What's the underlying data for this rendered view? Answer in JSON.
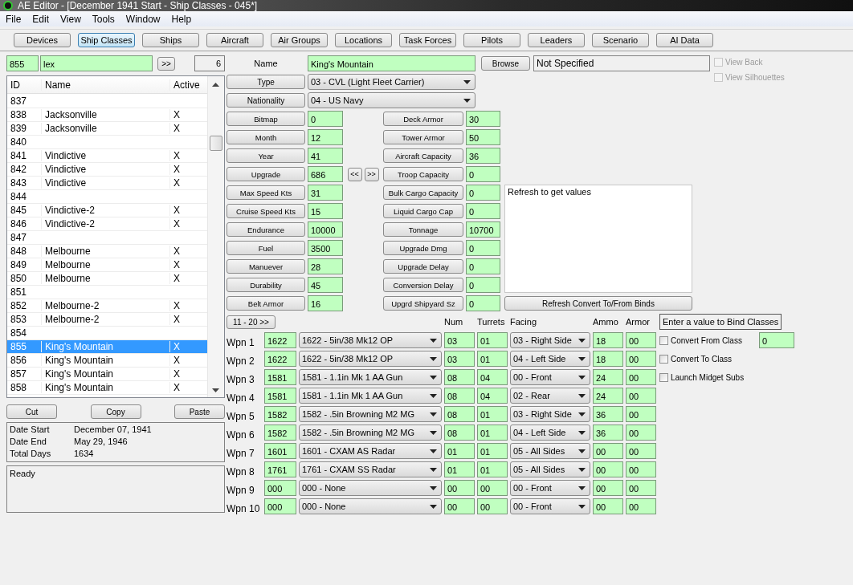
{
  "window": {
    "title": "AE Editor - [December 1941 Start - Ship Classes - 045*]"
  },
  "menu": [
    "File",
    "Edit",
    "View",
    "Tools",
    "Window",
    "Help"
  ],
  "toolbar": [
    {
      "label": "Devices",
      "selected": false
    },
    {
      "label": "Ship Classes",
      "selected": true
    },
    {
      "label": "Ships",
      "selected": false
    },
    {
      "label": "Aircraft",
      "selected": false
    },
    {
      "label": "Air Groups",
      "selected": false
    },
    {
      "label": "Locations",
      "selected": false
    },
    {
      "label": "Task Forces",
      "selected": false
    },
    {
      "label": "Pilots",
      "selected": false
    },
    {
      "label": "Leaders",
      "selected": false
    },
    {
      "label": "Scenario",
      "selected": false
    },
    {
      "label": "AI Data",
      "selected": false
    }
  ],
  "search": {
    "id": "855",
    "text": "lex",
    "go": ">>",
    "count": "6"
  },
  "list": {
    "columns": [
      "ID",
      "Name",
      "Active"
    ],
    "rows": [
      {
        "id": "837",
        "selected": false
      },
      {
        "id": "838",
        "name": "Jacksonville",
        "active": "X",
        "selected": false
      },
      {
        "id": "839",
        "name": "Jacksonville",
        "active": "X",
        "selected": false
      },
      {
        "id": "840",
        "selected": false
      },
      {
        "id": "841",
        "name": "Vindictive",
        "active": "X",
        "selected": false
      },
      {
        "id": "842",
        "name": "Vindictive",
        "active": "X",
        "selected": false
      },
      {
        "id": "843",
        "name": "Vindictive",
        "active": "X",
        "selected": false
      },
      {
        "id": "844",
        "selected": false
      },
      {
        "id": "845",
        "name": "Vindictive-2",
        "active": "X",
        "selected": false
      },
      {
        "id": "846",
        "name": "Vindictive-2",
        "active": "X",
        "selected": false
      },
      {
        "id": "847",
        "selected": false
      },
      {
        "id": "848",
        "name": "Melbourne",
        "active": "X",
        "selected": false
      },
      {
        "id": "849",
        "name": "Melbourne",
        "active": "X",
        "selected": false
      },
      {
        "id": "850",
        "name": "Melbourne",
        "active": "X",
        "selected": false
      },
      {
        "id": "851",
        "selected": false
      },
      {
        "id": "852",
        "name": "Melbourne-2",
        "active": "X",
        "selected": false
      },
      {
        "id": "853",
        "name": "Melbourne-2",
        "active": "X",
        "selected": false
      },
      {
        "id": "854",
        "selected": false
      },
      {
        "id": "855",
        "name": "King's Mountain",
        "active": "X",
        "selected": true
      },
      {
        "id": "856",
        "name": "King's Mountain",
        "active": "X",
        "selected": false
      },
      {
        "id": "857",
        "name": "King's Mountain",
        "active": "X",
        "selected": false
      },
      {
        "id": "858",
        "name": "King's Mountain",
        "active": "X",
        "selected": false
      }
    ]
  },
  "list_buttons": [
    "Cut",
    "Copy",
    "Paste"
  ],
  "dates": [
    {
      "label": "Date Start",
      "value": "December 07, 1941"
    },
    {
      "label": "Date End",
      "value": "May 29, 1946"
    },
    {
      "label": "Total Days",
      "value": "1634"
    }
  ],
  "status": "Ready",
  "form": {
    "name_label": "Name",
    "name": "King's Mountain",
    "browse": "Browse",
    "bitmap_file": "Not Specified",
    "view_options": [
      {
        "label": "View Back",
        "checked": false,
        "disabled": true
      },
      {
        "label": "View Silhouettes",
        "checked": false,
        "disabled": true
      }
    ],
    "selects": [
      {
        "label": "Type",
        "value": "03 - CVL (Light Fleet Carrier)"
      },
      {
        "label": "Nationality",
        "value": "04 - US Navy"
      }
    ],
    "stats_left": [
      {
        "label": "Bitmap",
        "value": "0"
      },
      {
        "label": "Month",
        "value": "12"
      },
      {
        "label": "Year",
        "value": "41"
      },
      {
        "label": "Upgrade",
        "value": "686",
        "nav": [
          "<<",
          ">>"
        ]
      },
      {
        "label": "Max Speed Kts",
        "value": "31"
      },
      {
        "label": "Cruise Speed Kts",
        "value": "15"
      },
      {
        "label": "Endurance",
        "value": "10000"
      },
      {
        "label": "Fuel",
        "value": "3500"
      },
      {
        "label": "Manuever",
        "value": "28"
      },
      {
        "label": "Durability",
        "value": "45"
      },
      {
        "label": "Belt Armor",
        "value": "16"
      }
    ],
    "stats_right": [
      {
        "label": "Deck Armor",
        "value": "30"
      },
      {
        "label": "Tower Armor",
        "value": "50"
      },
      {
        "label": "Aircraft Capacity",
        "value": "36"
      },
      {
        "label": "Troop Capacity",
        "value": "0"
      },
      {
        "label": "Bulk Cargo Capacity",
        "value": "0"
      },
      {
        "label": "Liquid Cargo Cap",
        "value": "0"
      },
      {
        "label": "Tonnage",
        "value": "10700"
      },
      {
        "label": "Upgrade Dmg",
        "value": "0"
      },
      {
        "label": "Upgrade Delay",
        "value": "0"
      },
      {
        "label": "Conversion Delay",
        "value": "0"
      },
      {
        "label": "Upgrd Shipyard Sz",
        "value": "0"
      }
    ],
    "notes": "Refresh to get values",
    "refresh": "Refresh Convert To/From Binds"
  },
  "weapons": {
    "page_button": "11 - 20  >>",
    "columns": [
      "Num",
      "Turrets",
      "Facing",
      "Ammo",
      "Armor"
    ],
    "rows": [
      {
        "label": "Wpn 1",
        "id": "1622",
        "device": "1622 - 5in/38 Mk12 OP",
        "num": "03",
        "turrets": "01",
        "facing": "03 - Right Side",
        "ammo": "18",
        "armor": "00"
      },
      {
        "label": "Wpn 2",
        "id": "1622",
        "device": "1622 - 5in/38 Mk12 OP",
        "num": "03",
        "turrets": "01",
        "facing": "04 - Left Side",
        "ammo": "18",
        "armor": "00"
      },
      {
        "label": "Wpn 3",
        "id": "1581",
        "device": "1581 - 1.1in Mk 1 AA Gun",
        "num": "08",
        "turrets": "04",
        "facing": "00 - Front",
        "ammo": "24",
        "armor": "00"
      },
      {
        "label": "Wpn 4",
        "id": "1581",
        "device": "1581 - 1.1in Mk 1 AA Gun",
        "num": "08",
        "turrets": "04",
        "facing": "02 - Rear",
        "ammo": "24",
        "armor": "00"
      },
      {
        "label": "Wpn 5",
        "id": "1582",
        "device": "1582 - .5in Browning M2 MG",
        "num": "08",
        "turrets": "01",
        "facing": "03 - Right Side",
        "ammo": "36",
        "armor": "00"
      },
      {
        "label": "Wpn 6",
        "id": "1582",
        "device": "1582 - .5in Browning M2 MG",
        "num": "08",
        "turrets": "01",
        "facing": "04 - Left Side",
        "ammo": "36",
        "armor": "00"
      },
      {
        "label": "Wpn 7",
        "id": "1601",
        "device": "1601 - CXAM AS Radar",
        "num": "01",
        "turrets": "01",
        "facing": "05 - All Sides",
        "ammo": "00",
        "armor": "00"
      },
      {
        "label": "Wpn 8",
        "id": "1761",
        "device": "1761 - CXAM SS Radar",
        "num": "01",
        "turrets": "01",
        "facing": "05 - All Sides",
        "ammo": "00",
        "armor": "00"
      },
      {
        "label": "Wpn 9",
        "id": "000",
        "device": "000 - None",
        "num": "00",
        "turrets": "00",
        "facing": "00 - Front",
        "ammo": "00",
        "armor": "00"
      },
      {
        "label": "Wpn 10",
        "id": "000",
        "device": "000 - None",
        "num": "00",
        "turrets": "00",
        "facing": "00 - Front",
        "ammo": "00",
        "armor": "00"
      }
    ]
  },
  "bind": {
    "hint": "Enter a value to Bind Classes",
    "options": [
      {
        "label": "Convert From Class",
        "checked": false,
        "value": "0"
      },
      {
        "label": "Convert To Class",
        "checked": false
      },
      {
        "label": "Launch Midget Subs",
        "checked": false
      }
    ]
  }
}
